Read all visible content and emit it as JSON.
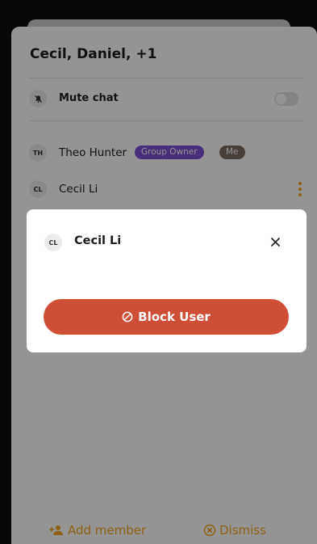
{
  "sheet": {
    "title": "Cecil, Daniel, +1",
    "mute": {
      "label": "Mute chat",
      "enabled": false,
      "icon": "bell-off-icon"
    },
    "members": [
      {
        "initials": "TH",
        "name": "Theo Hunter",
        "badges": [
          "Group Owner",
          "Me"
        ]
      },
      {
        "initials": "CL",
        "name": "Cecil Li",
        "menu_icon": "kebab-icon"
      }
    ],
    "footer": {
      "add_member_label": "Add member",
      "add_member_icon": "add-person-icon",
      "dismiss_label": "Dismiss",
      "dismiss_icon": "circle-x-icon"
    }
  },
  "modal": {
    "initials": "CL",
    "name": "Cecil Li",
    "close_icon": "close-icon",
    "block_label": "Block User",
    "block_icon": "block-icon"
  },
  "colors": {
    "accent": "#f5a623",
    "danger": "#cf4f36",
    "owner_badge": "#7b4fd3",
    "me_badge": "#7a6b62"
  }
}
